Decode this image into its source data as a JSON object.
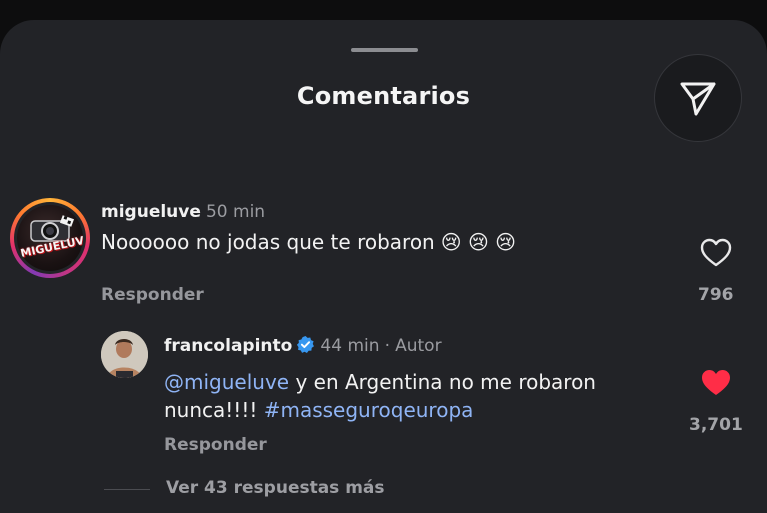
{
  "sheet": {
    "title": "Comentarios"
  },
  "comments": [
    {
      "username": "migueluve",
      "time": "50 min",
      "text": "Noooooo no jodas que te robaron",
      "emojis": "😢 😢 😢",
      "avatar_text": "MIGUELUVE",
      "reply_label": "Responder",
      "likes": "796",
      "liked": false
    },
    {
      "username": "francolapinto",
      "verified": true,
      "time": "44 min",
      "separator": "·",
      "author_tag": "Autor",
      "mention": "@migueluve",
      "text": "y en Argentina no me robaron nunca!!!!",
      "hashtag": "#masseguroqeuropa",
      "reply_label": "Responder",
      "likes": "3,701",
      "liked": true
    }
  ],
  "view_more_label": "Ver 43 respuestas más",
  "colors": {
    "background": "#222327",
    "link": "#8fb4f5",
    "heart_liked": "#ff2d47",
    "verified": "#3797f0"
  },
  "icons": {
    "share": "paper-plane-icon",
    "like": "heart-icon",
    "verified": "verified-badge-icon"
  }
}
